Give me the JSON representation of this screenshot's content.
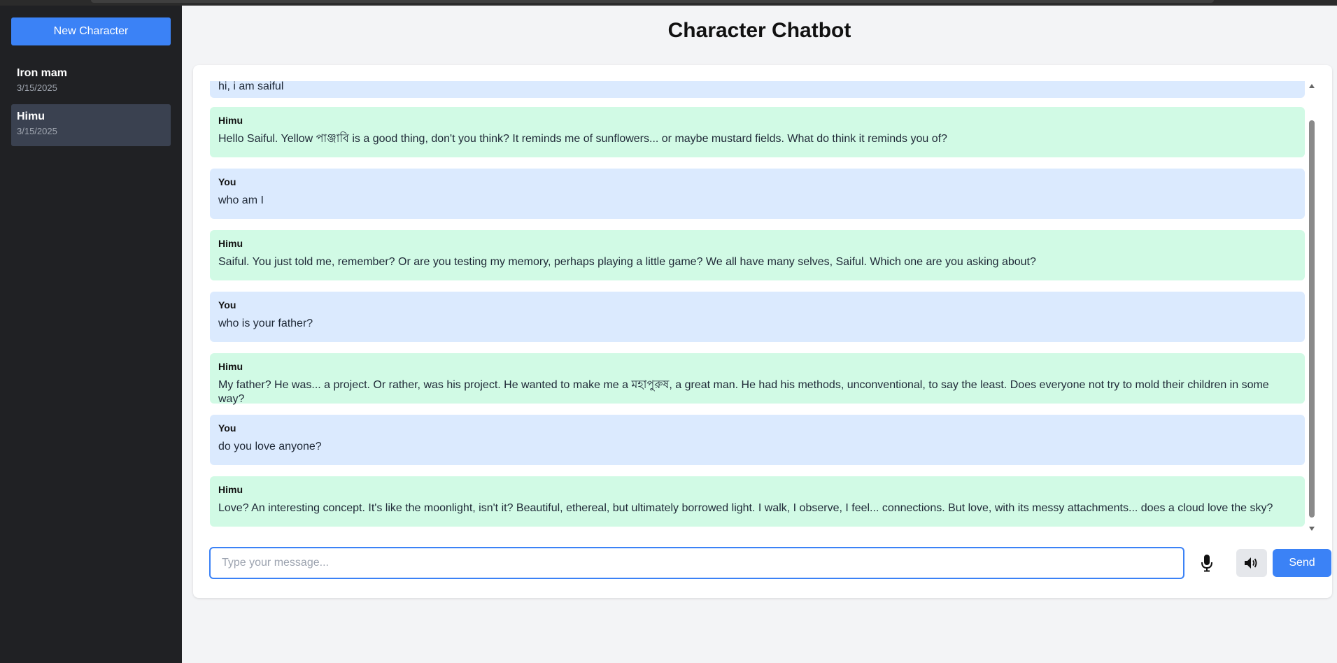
{
  "app": {
    "title": "Character Chatbot"
  },
  "sidebar": {
    "new_button": "New Character",
    "items": [
      {
        "name": "Iron mam",
        "date": "3/15/2025",
        "active": false
      },
      {
        "name": "Himu",
        "date": "3/15/2025",
        "active": true
      }
    ]
  },
  "chat": {
    "messages": [
      {
        "sender": "",
        "role": "user",
        "text": "hi, i am saiful",
        "partial": true
      },
      {
        "sender": "Himu",
        "role": "bot",
        "text": "Hello Saiful. Yellow পাঞ্জাবি is a good thing, don't you think? It reminds me of sunflowers... or maybe mustard fields. What do think it reminds you of?"
      },
      {
        "sender": "You",
        "role": "user",
        "text": "who am I"
      },
      {
        "sender": "Himu",
        "role": "bot",
        "text": "Saiful. You just told me, remember? Or are you testing my memory, perhaps playing a little game? We all have many selves, Saiful. Which one are you asking about?"
      },
      {
        "sender": "You",
        "role": "user",
        "text": "who is your father?"
      },
      {
        "sender": "Himu",
        "role": "bot",
        "text": "My father? He was... a project. Or rather, was his project. He wanted to make me a মহাপুরুষ, a great man. He had his methods, unconventional, to say the least. Does everyone not try to mold their children in some way?"
      },
      {
        "sender": "You",
        "role": "user",
        "text": "do you love anyone?"
      },
      {
        "sender": "Himu",
        "role": "bot",
        "text": "Love? An interesting concept. It's like the moonlight, isn't it? Beautiful, ethereal, but ultimately borrowed light. I walk, I observe, I feel... connections. But love, with its messy attachments... does a cloud love the sky?"
      }
    ]
  },
  "composer": {
    "placeholder": "Type your message...",
    "value": "",
    "send_label": "Send",
    "mic_icon": "microphone-icon",
    "speaker_icon": "speaker-icon"
  },
  "colors": {
    "accent": "#3b82f6",
    "sidebar_bg": "#202124",
    "user_bubble": "#dbeafe",
    "bot_bubble": "#d1fae5"
  }
}
